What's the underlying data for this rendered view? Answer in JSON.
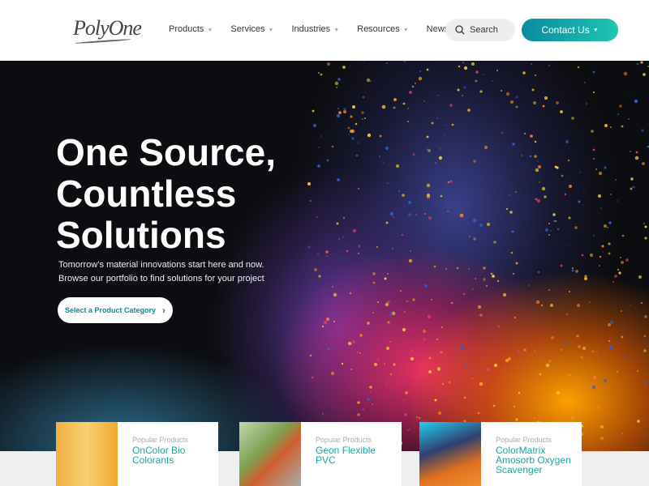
{
  "header": {
    "logo": "PolyOne",
    "nav": [
      {
        "label": "Products",
        "dropdown": true
      },
      {
        "label": "Services",
        "dropdown": true
      },
      {
        "label": "Industries",
        "dropdown": true
      },
      {
        "label": "Resources",
        "dropdown": true
      },
      {
        "label": "News",
        "dropdown": false
      }
    ],
    "search_label": "Search",
    "contact_label": "Contact Us",
    "accent": "#15a9a8"
  },
  "hero": {
    "title_lines": [
      "One Source,",
      "Countless",
      "Solutions"
    ],
    "subtitle_lines": [
      "Tomorrow’s material innovations start here and now.",
      "Browse our portfolio to find solutions for your project"
    ],
    "cta_label": "Select a Product Category"
  },
  "cards": [
    {
      "label": "Popular Products",
      "title_lines": [
        "OnColor Bio",
        "Colorants"
      ]
    },
    {
      "label": "Popular Products",
      "title_lines": [
        "Geon Flexible",
        "PVC"
      ]
    },
    {
      "label": "Popular Products",
      "title_lines": [
        "ColorMatrix",
        "Amosorb Oxygen",
        "Scavenger"
      ]
    }
  ]
}
